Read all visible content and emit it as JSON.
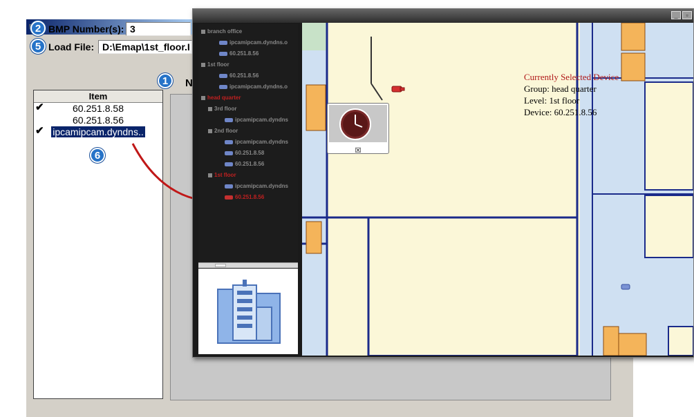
{
  "dialog": {
    "bmp_label": "BMP Number(s):",
    "bmp_value": "3",
    "load_label": "Load File:",
    "load_value": "D:\\Emap\\1st_floor.I",
    "list_header": "Item",
    "list_items": [
      {
        "label": "60.251.8.58",
        "checked": true,
        "selected": false
      },
      {
        "label": "60.251.8.56",
        "checked": false,
        "selected": false
      },
      {
        "label": "ipcamipcam.dyndns..",
        "checked": true,
        "selected": true
      }
    ],
    "name_col_partial": "N"
  },
  "badges": {
    "b2": "2",
    "b5": "5",
    "b1": "1",
    "b6": "6"
  },
  "emap": {
    "tree": [
      {
        "label": "branch office",
        "kind": "group",
        "red": false
      },
      {
        "label": "ipcamipcam.dyndns.o",
        "kind": "cam",
        "red": false
      },
      {
        "label": "60.251.8.56",
        "kind": "cam",
        "red": false
      },
      {
        "label": "1st floor",
        "kind": "group",
        "red": false
      },
      {
        "label": "60.251.8.56",
        "kind": "cam",
        "red": false
      },
      {
        "label": "ipcamipcam.dyndns.o",
        "kind": "cam",
        "red": false
      },
      {
        "label": "head quarter",
        "kind": "group",
        "red": true
      },
      {
        "label": "3rd floor",
        "kind": "group",
        "red": false
      },
      {
        "label": "ipcamipcam.dyndns",
        "kind": "cam",
        "red": false
      },
      {
        "label": "2nd floor",
        "kind": "group",
        "red": false
      },
      {
        "label": "ipcamipcam.dyndns",
        "kind": "cam",
        "red": false
      },
      {
        "label": "60.251.8.58",
        "kind": "cam",
        "red": false
      },
      {
        "label": "60.251.8.56",
        "kind": "cam",
        "red": false
      },
      {
        "label": "1st floor",
        "kind": "group",
        "red": true
      },
      {
        "label": "ipcamipcam.dyndns",
        "kind": "cam",
        "red": false
      },
      {
        "label": "60.251.8.56",
        "kind": "cam",
        "red": true
      }
    ],
    "info": {
      "title": "Currently Selected Device",
      "group": "Group: head quarter",
      "level": "Level: 1st floor",
      "device": "Device: 60.251.8.56"
    },
    "popup_close": "☒"
  },
  "colors": {
    "badge": "#2673c8",
    "arrow": "#c01818",
    "selection": "#0a246a"
  }
}
